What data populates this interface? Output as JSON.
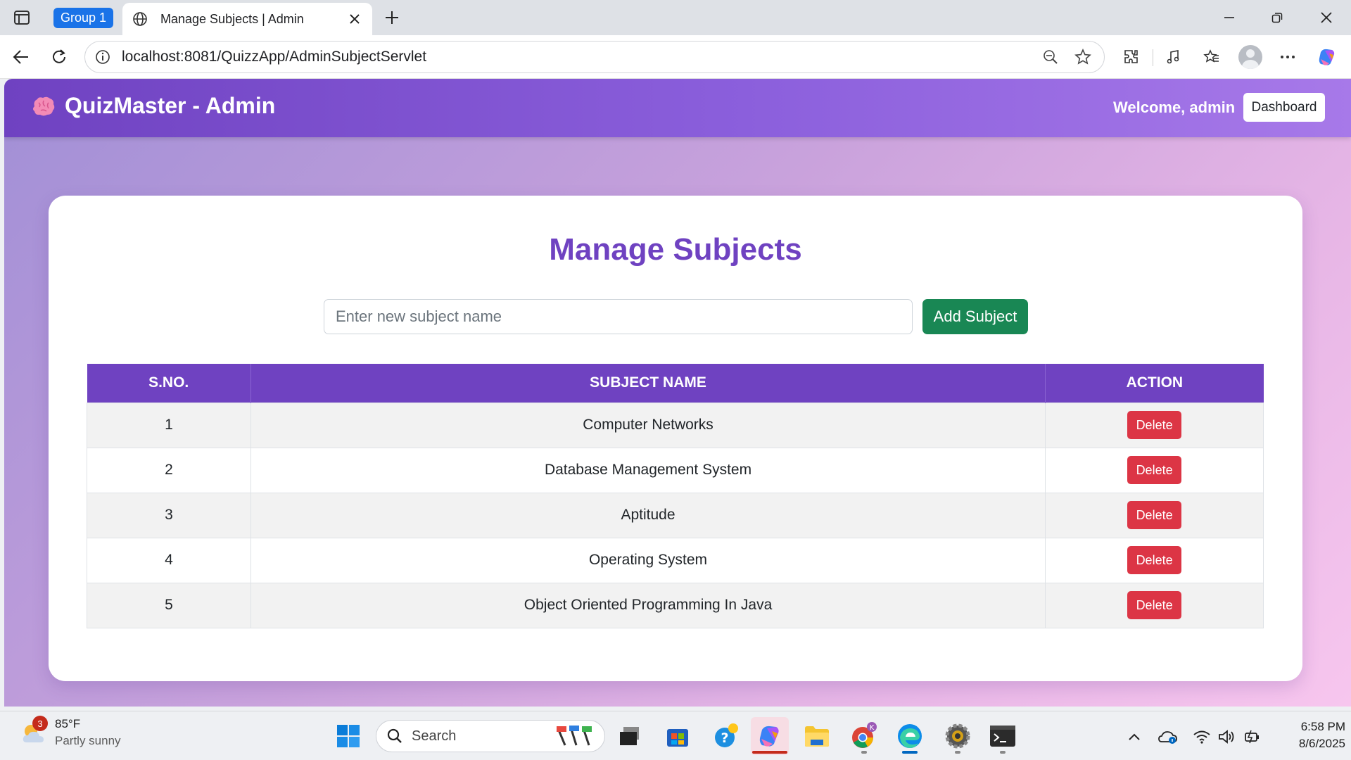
{
  "browser": {
    "tab_group_label": "Group 1",
    "tab_title": "Manage Subjects | Admin",
    "url": "localhost:8081/QuizzApp/AdminSubjectServlet"
  },
  "navbar": {
    "brand": "QuizMaster - Admin",
    "welcome": "Welcome, admin",
    "dashboard_label": "Dashboard"
  },
  "page": {
    "title": "Manage Subjects",
    "input_placeholder": "Enter new subject name",
    "input_value": "",
    "add_button_label": "Add Subject"
  },
  "table": {
    "headers": [
      "S.NO.",
      "SUBJECT NAME",
      "ACTION"
    ],
    "rows": [
      {
        "sno": "1",
        "name": "Computer Networks",
        "action": "Delete"
      },
      {
        "sno": "2",
        "name": "Database Management System",
        "action": "Delete"
      },
      {
        "sno": "3",
        "name": "Aptitude",
        "action": "Delete"
      },
      {
        "sno": "4",
        "name": "Operating System",
        "action": "Delete"
      },
      {
        "sno": "5",
        "name": "Object Oriented Programming In Java",
        "action": "Delete"
      }
    ]
  },
  "taskbar": {
    "weather_temp": "85°F",
    "weather_condition": "Partly sunny",
    "weather_badge": "3",
    "search_label": "Search",
    "time": "6:58 PM",
    "date": "8/6/2025"
  },
  "colors": {
    "primary_purple": "#6f42c1",
    "success_green": "#198754",
    "danger_red": "#dc3545"
  }
}
